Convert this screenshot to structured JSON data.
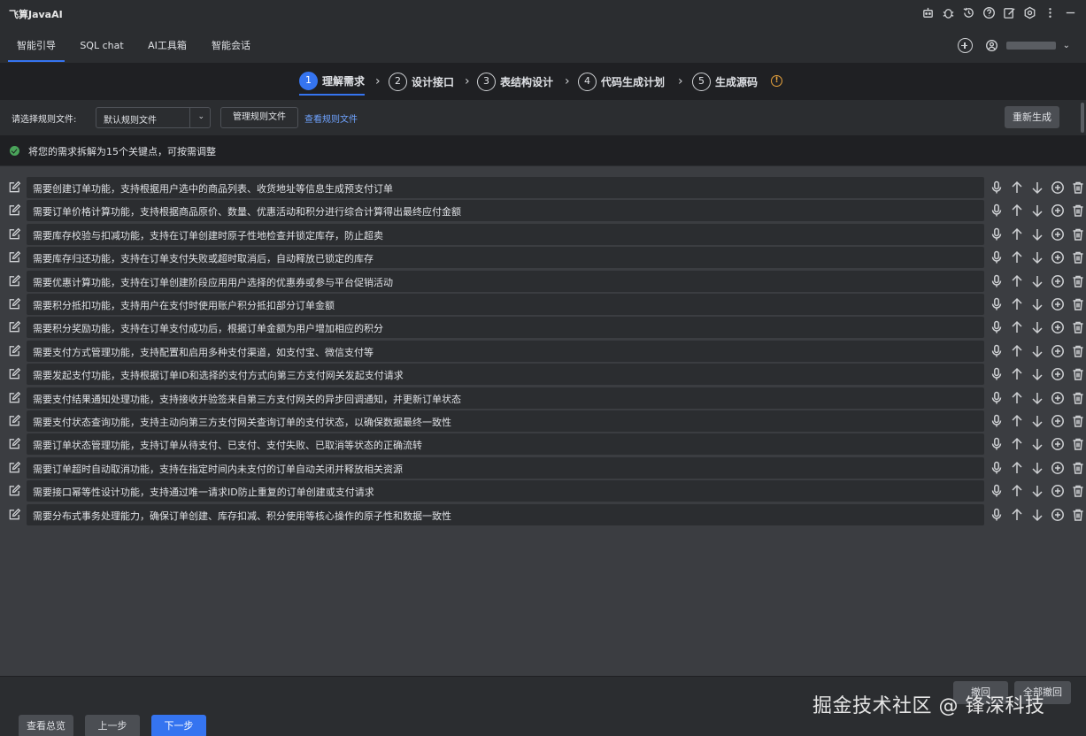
{
  "app": {
    "title": "飞算JavaAI"
  },
  "titlebar_icons": [
    "robot-icon",
    "bug-icon",
    "history-icon",
    "help-icon",
    "edit-icon",
    "settings-icon",
    "more-icon",
    "minimize-icon"
  ],
  "tabs": [
    {
      "label": "智能引导",
      "active": true
    },
    {
      "label": "SQL chat",
      "active": false
    },
    {
      "label": "AI工具箱",
      "active": false
    },
    {
      "label": "智能会话",
      "active": false
    }
  ],
  "steps": [
    {
      "num": "1",
      "label": "理解需求",
      "active": true
    },
    {
      "num": "2",
      "label": "设计接口",
      "active": false
    },
    {
      "num": "3",
      "label": "表结构设计",
      "active": false
    },
    {
      "num": "4",
      "label": "代码生成计划",
      "active": false
    },
    {
      "num": "5",
      "label": "生成源码",
      "active": false
    }
  ],
  "steps_info_icon": "!",
  "rules": {
    "label": "请选择规则文件:",
    "selected": "默认规则文件",
    "manage_label": "管理规则文件",
    "view_label": "查看规则文件",
    "regenerate_label": "重新生成"
  },
  "info": {
    "text": "将您的需求拆解为15个关键点，可按需调整"
  },
  "requirements": [
    "需要创建订单功能，支持根据用户选中的商品列表、收货地址等信息生成预支付订单",
    "需要订单价格计算功能，支持根据商品原价、数量、优惠活动和积分进行综合计算得出最终应付金额",
    "需要库存校验与扣减功能，支持在订单创建时原子性地检查并锁定库存，防止超卖",
    "需要库存归还功能，支持在订单支付失败或超时取消后，自动释放已锁定的库存",
    "需要优惠计算功能，支持在订单创建阶段应用用户选择的优惠券或参与平台促销活动",
    "需要积分抵扣功能，支持用户在支付时使用账户积分抵扣部分订单金额",
    "需要积分奖励功能，支持在订单支付成功后，根据订单金额为用户增加相应的积分",
    "需要支付方式管理功能，支持配置和启用多种支付渠道，如支付宝、微信支付等",
    "需要发起支付功能，支持根据订单ID和选择的支付方式向第三方支付网关发起支付请求",
    "需要支付结果通知处理功能，支持接收并验签来自第三方支付网关的异步回调通知，并更新订单状态",
    "需要支付状态查询功能，支持主动向第三方支付网关查询订单的支付状态，以确保数据最终一致性",
    "需要订单状态管理功能，支持订单从待支付、已支付、支付失败、已取消等状态的正确流转",
    "需要订单超时自动取消功能，支持在指定时间内未支付的订单自动关闭并释放相关资源",
    "需要接口幂等性设计功能，支持通过唯一请求ID防止重复的订单创建或支付请求",
    "需要分布式事务处理能力，确保订单创建、库存扣减、积分使用等核心操作的原子性和数据一致性"
  ],
  "bottom": {
    "withdraw_label": "撤回",
    "withdraw_all_label": "全部撤回"
  },
  "footer": {
    "overview_label": "查看总览",
    "prev_label": "上一步",
    "next_label": "下一步"
  },
  "watermark": "掘金技术社区 @ 锋深科技",
  "colors": {
    "accent": "#3574f0",
    "success": "#4aa45a",
    "warning": "#e8a33d",
    "link": "#6fa3ff"
  }
}
